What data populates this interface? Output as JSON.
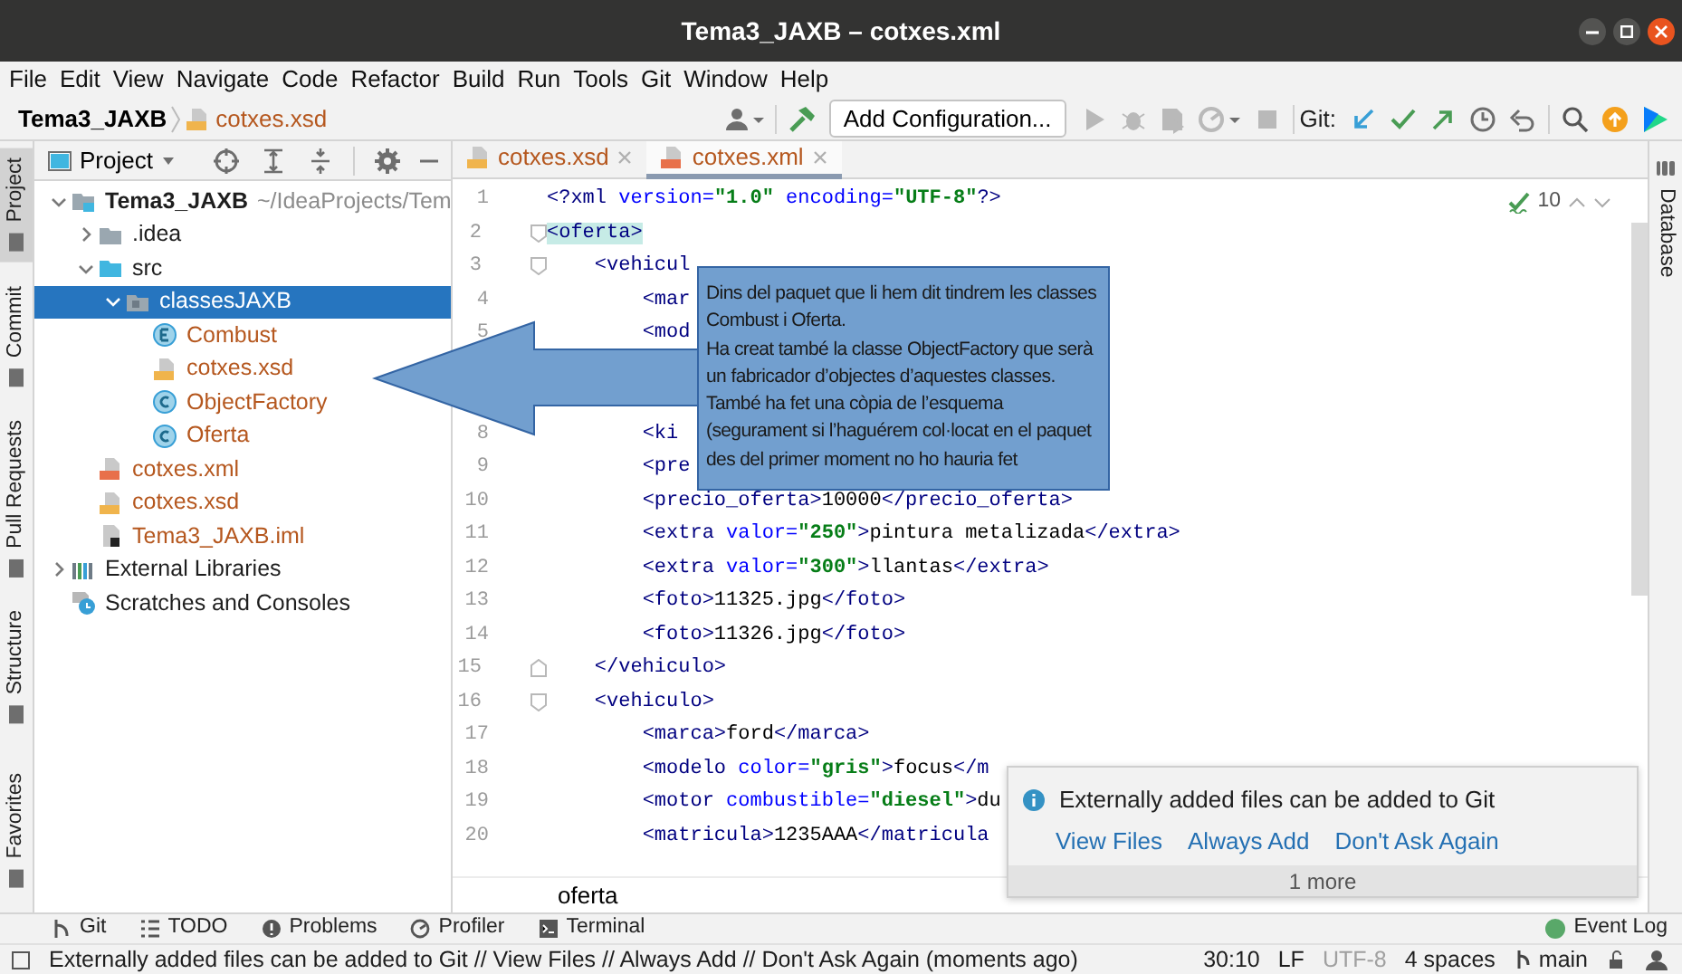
{
  "window": {
    "title": "Tema3_JAXB – cotxes.xml"
  },
  "menu": [
    "File",
    "Edit",
    "View",
    "Navigate",
    "Code",
    "Refactor",
    "Build",
    "Run",
    "Tools",
    "Git",
    "Window",
    "Help"
  ],
  "navigation_bar": {
    "breadcrumb": [
      {
        "label": "Tema3_JAXB",
        "kind": "project"
      },
      {
        "label": "cotxes.xsd",
        "kind": "xsd"
      }
    ],
    "run_configuration": "Add Configuration...",
    "run_actions": [
      {
        "disabled": true
      },
      {
        "disabled": true
      },
      {
        "disabled": true
      },
      {
        "disabled": true
      },
      {
        "disabled": true
      }
    ],
    "git_label": "Git:"
  },
  "left_stripe": [
    {
      "label": "Project",
      "selected": true
    },
    {
      "label": "Commit",
      "selected": false
    },
    {
      "label": "Pull Requests",
      "selected": false
    },
    {
      "label": "Structure",
      "selected": false
    },
    {
      "label": "Favorites",
      "selected": false
    }
  ],
  "right_stripe": [
    {
      "label": "Database",
      "selected": false
    }
  ],
  "project_panel": {
    "title": "Project",
    "tree": [
      {
        "label": "Tema3_JAXB",
        "kind": "module",
        "hint": "~/IdeaProjects/Tem",
        "expanded": true,
        "selected": false,
        "children": [
          {
            "label": ".idea",
            "kind": "folder",
            "expanded": false,
            "selected": false
          },
          {
            "label": "src",
            "kind": "source-folder",
            "expanded": true,
            "selected": false,
            "children": [
              {
                "label": "classesJAXB",
                "kind": "package",
                "expanded": true,
                "selected": true,
                "children": [
                  {
                    "label": "Combust",
                    "kind": "enum",
                    "color": "#b5571e",
                    "selected": false
                  },
                  {
                    "label": "cotxes.xsd",
                    "kind": "xsd",
                    "color": "#b5571e",
                    "selected": false
                  },
                  {
                    "label": "ObjectFactory",
                    "kind": "class",
                    "color": "#b5571e",
                    "selected": false
                  },
                  {
                    "label": "Oferta",
                    "kind": "class",
                    "color": "#b5571e",
                    "selected": false
                  }
                ]
              }
            ]
          },
          {
            "label": "cotxes.xml",
            "kind": "xml",
            "color": "#b5571e",
            "selected": false
          },
          {
            "label": "cotxes.xsd",
            "kind": "xsd",
            "color": "#b5571e",
            "selected": false
          },
          {
            "label": "Tema3_JAXB.iml",
            "kind": "iml",
            "color": "#b5571e",
            "selected": false
          }
        ]
      },
      {
        "label": "External Libraries",
        "kind": "libraries",
        "expanded": false,
        "selected": false
      },
      {
        "label": "Scratches and Consoles",
        "kind": "scratches",
        "selected": false
      }
    ]
  },
  "editor": {
    "tabs": [
      {
        "label": "cotxes.xsd",
        "kind": "xsd",
        "selected": false
      },
      {
        "label": "cotxes.xml",
        "kind": "xml",
        "selected": true
      }
    ],
    "inspections": "10",
    "lines": [
      {
        "number": "1",
        "code": [
          {
            "kind": "tag",
            "text": "<?xml"
          },
          {
            "kind": "attr",
            "text": " version="
          },
          {
            "kind": "value",
            "text": "\"1.0\""
          },
          {
            "kind": "attr",
            "text": " encoding="
          },
          {
            "kind": "value",
            "text": "\"UTF-8\""
          },
          {
            "kind": "tag",
            "text": "?>"
          }
        ]
      },
      {
        "number": "2",
        "fold_start": true,
        "code": [
          {
            "kind": "tag-match",
            "text": "<oferta>"
          }
        ]
      },
      {
        "number": "3",
        "fold_start": true,
        "code": [
          {
            "kind": "tag",
            "text": "    <vehicul"
          }
        ]
      },
      {
        "number": "4",
        "code": [
          {
            "kind": "tag",
            "text": "        <mar"
          }
        ]
      },
      {
        "number": "5",
        "code": [
          {
            "kind": "tag",
            "text": "        <mod"
          }
        ]
      },
      {
        "covered": true
      },
      {
        "covered": true
      },
      {
        "number": "8",
        "code": [
          {
            "kind": "tag",
            "text": "        <ki"
          }
        ]
      },
      {
        "number": "9",
        "code": [
          {
            "kind": "tag",
            "text": "        <pre"
          }
        ]
      },
      {
        "number": "10",
        "code": [
          {
            "kind": "tag",
            "text": "        <precio_oferta>"
          },
          {
            "kind": "text",
            "text": "10000"
          },
          {
            "kind": "tag",
            "text": "</precio_oferta>"
          }
        ]
      },
      {
        "number": "11",
        "code": [
          {
            "kind": "tag",
            "text": "        <extra"
          },
          {
            "kind": "attr",
            "text": " valor="
          },
          {
            "kind": "value",
            "text": "\"250\""
          },
          {
            "kind": "tag",
            "text": ">"
          },
          {
            "kind": "text",
            "text": "pintura metalizada"
          },
          {
            "kind": "tag",
            "text": "</extra>"
          }
        ]
      },
      {
        "number": "12",
        "code": [
          {
            "kind": "tag",
            "text": "        <extra"
          },
          {
            "kind": "attr",
            "text": " valor="
          },
          {
            "kind": "value",
            "text": "\"300\""
          },
          {
            "kind": "tag",
            "text": ">"
          },
          {
            "kind": "text",
            "text": "llantas"
          },
          {
            "kind": "tag",
            "text": "</extra>"
          }
        ]
      },
      {
        "number": "13",
        "code": [
          {
            "kind": "tag",
            "text": "        <foto>"
          },
          {
            "kind": "text",
            "text": "11325.jpg"
          },
          {
            "kind": "tag",
            "text": "</foto>"
          }
        ]
      },
      {
        "number": "14",
        "code": [
          {
            "kind": "tag",
            "text": "        <foto>"
          },
          {
            "kind": "text",
            "text": "11326.jpg"
          },
          {
            "kind": "tag",
            "text": "</foto>"
          }
        ]
      },
      {
        "number": "15",
        "fold_end": true,
        "code": [
          {
            "kind": "tag",
            "text": "    </vehiculo>"
          }
        ]
      },
      {
        "number": "16",
        "fold_start": true,
        "code": [
          {
            "kind": "tag",
            "text": "    <vehiculo>"
          }
        ]
      },
      {
        "number": "17",
        "code": [
          {
            "kind": "tag",
            "text": "        <marca>"
          },
          {
            "kind": "text",
            "text": "ford"
          },
          {
            "kind": "tag",
            "text": "</marca>"
          }
        ]
      },
      {
        "number": "18",
        "code": [
          {
            "kind": "tag",
            "text": "        <modelo"
          },
          {
            "kind": "attr",
            "text": " color="
          },
          {
            "kind": "value",
            "text": "\"gris\""
          },
          {
            "kind": "tag",
            "text": ">"
          },
          {
            "kind": "text",
            "text": "focus"
          },
          {
            "kind": "tag",
            "text": "</m"
          }
        ]
      },
      {
        "number": "19",
        "code": [
          {
            "kind": "tag",
            "text": "        <motor"
          },
          {
            "kind": "attr",
            "text": " combustible="
          },
          {
            "kind": "value",
            "text": "\"diesel\""
          },
          {
            "kind": "tag",
            "text": ">"
          },
          {
            "kind": "text",
            "text": "du"
          }
        ]
      },
      {
        "number": "20",
        "code": [
          {
            "kind": "tag",
            "text": "        <matricula>"
          },
          {
            "kind": "text",
            "text": "1235AAA"
          },
          {
            "kind": "tag",
            "text": "</matricula"
          }
        ]
      }
    ],
    "breadcrumb": "oferta"
  },
  "callout": {
    "paragraphs": [
      "Dins del paquet que li hem dit tindrem les classes Combust i Oferta.",
      "Ha creat també la classe ObjectFactory que serà un fabricador d’objectes d’aquestes classes.",
      "També ha fet una còpia de l’esquema (segurament si l’haguérem col·locat en el paquet des del primer moment no ho hauria fet"
    ]
  },
  "notification": {
    "title": "Externally added files can be added to Git",
    "actions": [
      "View Files",
      "Always Add",
      "Don't Ask Again"
    ],
    "more": "1 more"
  },
  "tool_windows": [
    {
      "label": "Git",
      "kind": "git"
    },
    {
      "label": "TODO",
      "kind": "todo"
    },
    {
      "label": "Problems",
      "kind": "problems"
    },
    {
      "label": "Profiler",
      "kind": "profiler"
    },
    {
      "label": "Terminal",
      "kind": "terminal"
    }
  ],
  "event_log": "Event Log",
  "status_bar": {
    "message": "Externally added files can be added to Git // View Files // Always Add // Don't Ask Again (moments ago)",
    "position": "30:10",
    "line_separator": "LF",
    "encoding": {
      "text": "UTF-8",
      "disabled": true
    },
    "indent": "4 spaces",
    "branch": "main"
  }
}
